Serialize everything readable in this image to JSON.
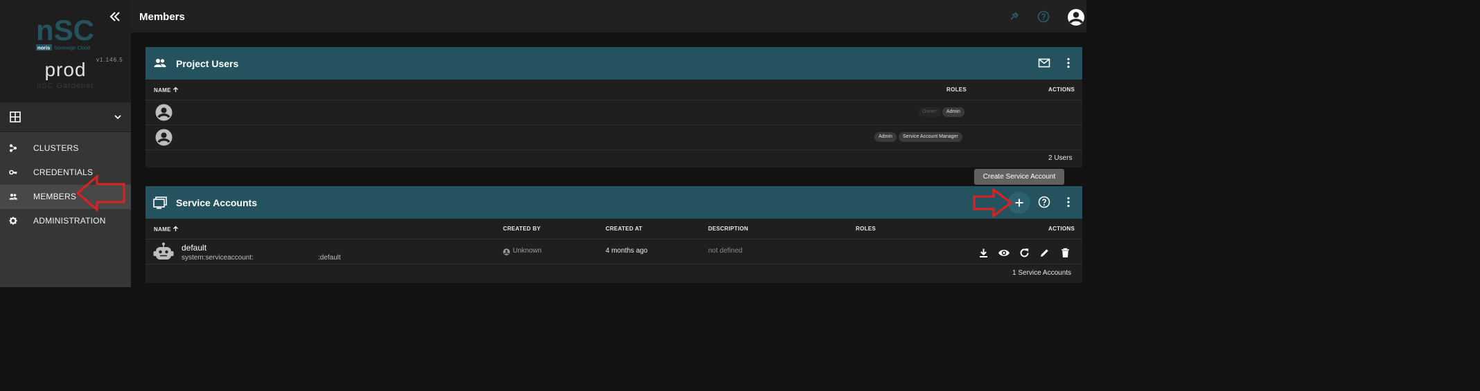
{
  "sidebar": {
    "logo": {
      "brand": "nSC",
      "tag_word": "noris",
      "tag_text": "Sovereign Cloud"
    },
    "version": "v1.146.5",
    "env_name": "prod",
    "env_sub": "nSC Gardener",
    "nav": [
      {
        "label": "CLUSTERS",
        "icon": "clusters-icon"
      },
      {
        "label": "CREDENTIALS",
        "icon": "key-icon"
      },
      {
        "label": "MEMBERS",
        "icon": "members-icon",
        "active": true
      },
      {
        "label": "ADMINISTRATION",
        "icon": "gear-icon"
      }
    ]
  },
  "topbar": {
    "title": "Members"
  },
  "project_users": {
    "title": "Project Users",
    "columns": {
      "name": "NAME",
      "roles": "ROLES",
      "actions": "ACTIONS"
    },
    "rows": [
      {
        "roles": [
          "Owner",
          "Admin"
        ]
      },
      {
        "roles": [
          "Admin",
          "Service Account Manager"
        ]
      }
    ],
    "footer": "2 Users"
  },
  "service_accounts": {
    "title": "Service Accounts",
    "tooltip": "Create Service Account",
    "columns": {
      "name": "NAME",
      "created_by": "CREATED BY",
      "created_at": "CREATED AT",
      "description": "DESCRIPTION",
      "roles": "ROLES",
      "actions": "ACTIONS"
    },
    "rows": [
      {
        "name": "default",
        "id_prefix": "system:serviceaccount:",
        "id_suffix": ":default",
        "created_by": "Unknown",
        "created_at": "4 months ago",
        "description": "not defined"
      }
    ],
    "footer": "1 Service Accounts"
  },
  "colors": {
    "accent": "#24525f",
    "annotation_arrow": "#e02020",
    "sidebar_bg": "#363636",
    "page_bg": "#121212"
  }
}
